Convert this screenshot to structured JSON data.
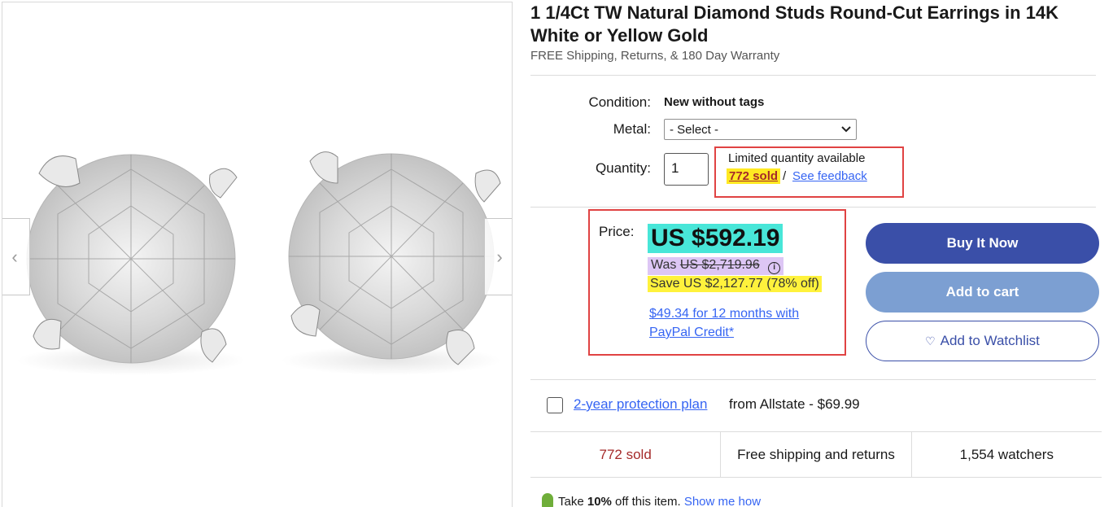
{
  "product": {
    "title": "1 1/4Ct TW Natural Diamond Studs Round-Cut Earrings in 14K White or Yellow Gold",
    "subtitle": "FREE Shipping, Returns, & 180 Day Warranty"
  },
  "gallery": {
    "prev_icon": "‹",
    "next_icon": "›"
  },
  "details": {
    "condition_label": "Condition:",
    "condition_value": "New without tags",
    "metal_label": "Metal:",
    "metal_selected": "- Select -",
    "quantity_label": "Quantity:",
    "quantity_value": "1",
    "availability": "Limited quantity available",
    "sold_link": "772 sold",
    "separator": "/",
    "feedback_link": "See feedback"
  },
  "pricing": {
    "price_label": "Price:",
    "price": "US $592.19",
    "was_label": "Was",
    "was_price": "US $2,719.96",
    "info_icon": "i",
    "save": "Save US $2,127.77 (78% off)",
    "paypal": "$49.34 for 12 months with PayPal Credit*"
  },
  "actions": {
    "buy_now": "Buy It Now",
    "add_to_cart": "Add to cart",
    "heart_icon": "♡",
    "watchlist": "Add to Watchlist"
  },
  "protection": {
    "link": "2-year protection plan",
    "rest": "from Allstate - $69.99"
  },
  "stats": {
    "sold": "772 sold",
    "shipping": "Free shipping and returns",
    "watchers": "1,554 watchers"
  },
  "promo": {
    "prefix": "Take ",
    "percent": "10%",
    "suffix": " off this item. ",
    "link": "Show me how"
  },
  "colors": {
    "buy_button": "#3a4fa8",
    "cart_button": "#7c9fd2",
    "link": "#3665f3",
    "price_highlight": "#48e6d8",
    "was_highlight": "#ddc6f5",
    "save_highlight": "#fff23c",
    "annotation_box": "#e04343"
  }
}
